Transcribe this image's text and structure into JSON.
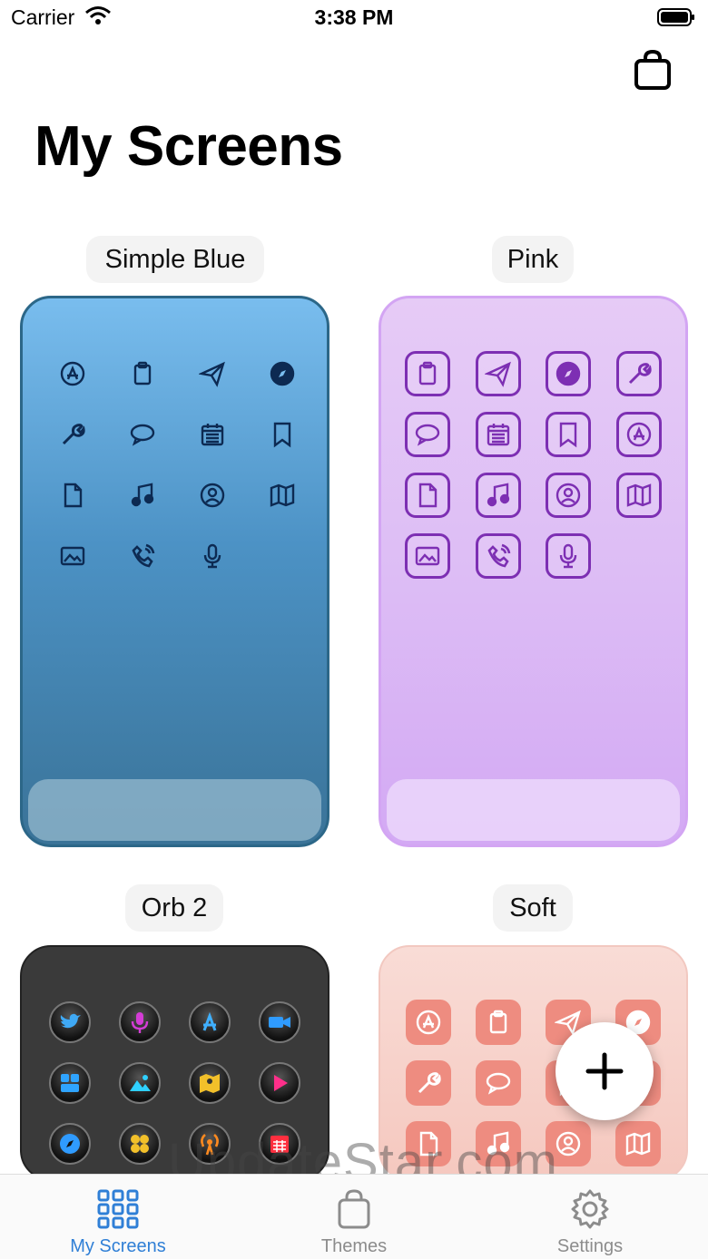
{
  "status_bar": {
    "carrier": "Carrier",
    "time": "3:38 PM"
  },
  "header": {
    "title": "My Screens",
    "shop_icon": "shopping-bag-icon"
  },
  "themes": [
    {
      "name": "Simple Blue",
      "icons": [
        "app-store-icon",
        "clipboard-icon",
        "paper-plane-icon",
        "compass-icon",
        "wrench-icon",
        "chat-bubble-icon",
        "calendar-icon",
        "bookmark-icon",
        "document-icon",
        "music-note-icon",
        "contact-icon",
        "map-icon",
        "photo-icon",
        "phone-icon",
        "microphone-icon"
      ]
    },
    {
      "name": "Pink",
      "icons": [
        "clipboard-icon",
        "paper-plane-icon",
        "compass-icon",
        "wrench-icon",
        "chat-bubble-icon",
        "calendar-icon",
        "bookmark-icon",
        "app-store-icon",
        "document-icon",
        "music-note-icon",
        "contact-icon",
        "map-icon",
        "photo-icon",
        "phone-icon",
        "microphone-icon"
      ]
    },
    {
      "name": "Orb 2",
      "icons": [
        "twitter-bird-icon",
        "microphone-icon",
        "app-store-icon",
        "video-camera-icon",
        "widgets-icon",
        "photo-icon",
        "maps-icon",
        "play-icon",
        "compass-icon",
        "calculator-icon",
        "podcast-icon",
        "calendar-icon"
      ]
    },
    {
      "name": "Soft",
      "icons": [
        "app-store-icon",
        "clipboard-icon",
        "paper-plane-icon",
        "compass-icon",
        "wrench-icon",
        "chat-bubble-icon",
        "bookmark-icon",
        "app-store-icon",
        "document-icon",
        "music-note-icon",
        "contact-icon",
        "map-icon"
      ]
    }
  ],
  "add_button": {
    "icon": "plus-icon"
  },
  "watermark": "UpdateStar.com",
  "tab_bar": {
    "items": [
      {
        "label": "My Screens",
        "icon": "grid-icon",
        "active": true
      },
      {
        "label": "Themes",
        "icon": "shopping-bag-icon",
        "active": false
      },
      {
        "label": "Settings",
        "icon": "gear-icon",
        "active": false
      }
    ]
  },
  "colors": {
    "accent": "#2f7fd6",
    "blue_icon": "#0d2a52",
    "pink_icon": "#7d2fb3",
    "soft_icon_bg": "#ee8c80"
  }
}
